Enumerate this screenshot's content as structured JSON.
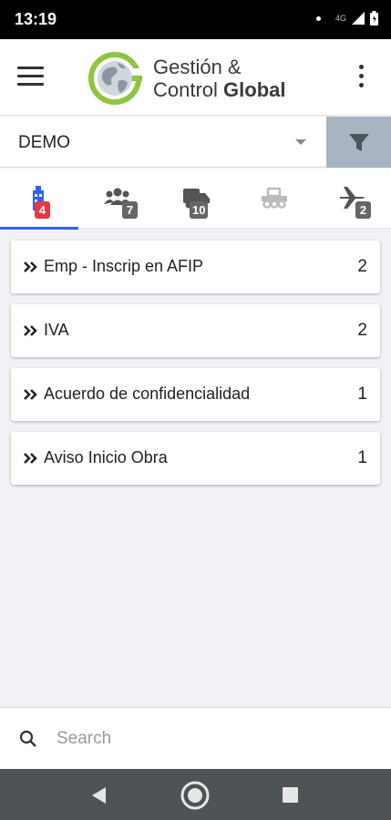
{
  "status_bar": {
    "time": "13:19",
    "network": "4G",
    "icons": [
      "notification-dot-icon",
      "signal-icon",
      "battery-icon"
    ]
  },
  "app_bar": {
    "logo_line1": "Gestión &",
    "logo_line2_regular": "Control",
    "logo_line2_bold": "Global",
    "icons": [
      "menu-icon",
      "logo-globe-icon",
      "more-vert-icon"
    ]
  },
  "selector": {
    "value": "DEMO",
    "filter_icon": "filter-icon"
  },
  "tabs": [
    {
      "icon": "company-icon",
      "badge": "4",
      "badge_color": "#e53945",
      "active": true
    },
    {
      "icon": "people-icon",
      "badge": "7",
      "badge_color": "#666666",
      "active": false
    },
    {
      "icon": "vehicles-icon",
      "badge": "10",
      "badge_color": "#666666",
      "active": false
    },
    {
      "icon": "machinery-icon",
      "badge": "",
      "badge_color": "",
      "active": false,
      "disabled": true
    },
    {
      "icon": "travel-icon",
      "badge": "2",
      "badge_color": "#666666",
      "active": false
    }
  ],
  "items": [
    {
      "label": "Emp - Inscrip en AFIP",
      "count": "2"
    },
    {
      "label": "IVA",
      "count": "2"
    },
    {
      "label": "Acuerdo de confidencialidad",
      "count": "1"
    },
    {
      "label": "Aviso Inicio Obra",
      "count": "1"
    }
  ],
  "search": {
    "placeholder": "Search",
    "value": ""
  },
  "colors": {
    "accent": "#2962ff",
    "alert_badge": "#e53945",
    "logo_green": "#8dc63f",
    "filter_bg": "#a8b4c0"
  }
}
